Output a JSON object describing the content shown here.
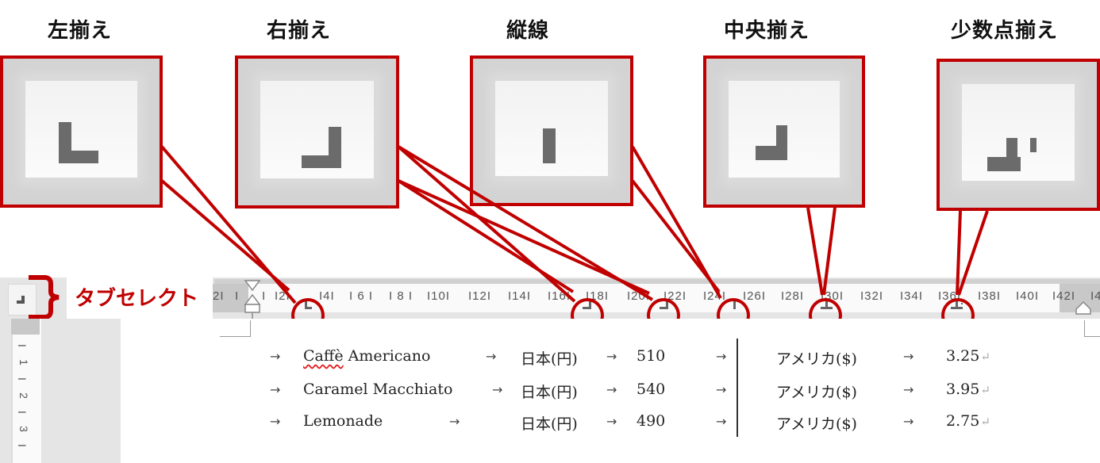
{
  "callouts": [
    {
      "title": "左揃え",
      "icon": "left-tab-icon"
    },
    {
      "title": "右揃え",
      "icon": "right-tab-icon"
    },
    {
      "title": "縦線",
      "icon": "bar-tab-icon"
    },
    {
      "title": "中央揃え",
      "icon": "center-tab-icon"
    },
    {
      "title": "少数点揃え",
      "icon": "decimal-tab-icon"
    }
  ],
  "tab_selector": {
    "label": "タブセレクト",
    "icon": "right-tab-icon"
  },
  "ruler": {
    "ticks": [
      "2I",
      "I",
      "I",
      "I2I",
      "I4I",
      "I 6 I",
      "I 8 I",
      "I10I",
      "I12I",
      "I14I",
      "I16I",
      "I18I",
      "I20I",
      "I22I",
      "I24I",
      "I26I",
      "I28I",
      "I30I",
      "I32I",
      "I34I",
      "I36I",
      "I38I",
      "I40I",
      "I42I",
      "I4"
    ],
    "vertical_ticks": [
      "I",
      "1",
      "I",
      "2",
      "I",
      "3",
      "I"
    ]
  },
  "document": {
    "rows": [
      {
        "name": "Caffè Americano",
        "jp_label": "日本(円)",
        "jp_price": "510",
        "us_label": "アメリカ($)",
        "us_price": "3.25"
      },
      {
        "name": "Caramel Macchiato",
        "jp_label": "日本(円)",
        "jp_price": "540",
        "us_label": "アメリカ($)",
        "us_price": "3.95"
      },
      {
        "name": "Lemonade",
        "jp_label": "日本(円)",
        "jp_price": "490",
        "us_label": "アメリカ($)",
        "us_price": "2.75"
      }
    ],
    "tab_arrow": "→",
    "paragraph_mark": "↵",
    "misspelled_word": "Caffè"
  },
  "colors": {
    "accent": "#c00000",
    "ruler": "#e5e5e5",
    "glyph": "#6b6b6b"
  }
}
